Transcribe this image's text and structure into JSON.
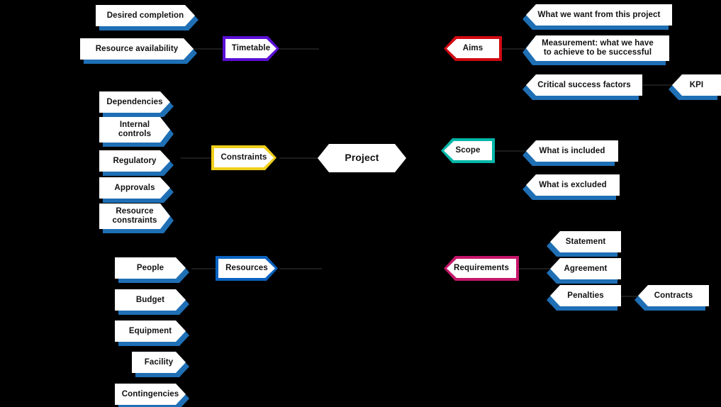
{
  "diagram": {
    "title": "Project scoping chevron diagram",
    "background": "#000000",
    "palette": {
      "shadow_blue": "#1f6fb5",
      "resources_blue": "#0b62c0",
      "timetable_purple": "#5b0fd6",
      "constraints_yellow": "#efcf1a",
      "aims_red": "#d00a12",
      "scope_teal": "#00b6a8",
      "requirements_magenta": "#c5176a",
      "node_fill": "#ffffff",
      "text": "#121212"
    },
    "center": {
      "label": "Project",
      "shape": "hexagon",
      "fill": "#ffffff"
    },
    "branches": [
      {
        "key": "timetable",
        "label": "Timetable",
        "accent": "#5b0fd6",
        "direction": "right",
        "children": [
          "Desired completion",
          "Resource availability"
        ]
      },
      {
        "key": "constraints",
        "label": "Constraints",
        "accent": "#efcf1a",
        "direction": "right",
        "children": [
          "Dependencies",
          "Internal controls",
          "Regulatory",
          "Approvals",
          "Resource constraints"
        ]
      },
      {
        "key": "resources",
        "label": "Resources",
        "accent": "#0b62c0",
        "direction": "right",
        "children": [
          "People",
          "Budget",
          "Equipment",
          "Facility",
          "Contingencies"
        ]
      },
      {
        "key": "aims",
        "label": "Aims",
        "accent": "#d00a12",
        "direction": "left",
        "children": [
          "What we want from this project",
          "Measurement: what we have to achieve to be successful",
          "Critical success factors"
        ],
        "grandchildren": [
          "KPI"
        ]
      },
      {
        "key": "scope",
        "label": "Scope",
        "accent": "#00b6a8",
        "direction": "left",
        "children": [
          "What is included",
          "What is excluded"
        ]
      },
      {
        "key": "requirements",
        "label": "Requirements",
        "accent": "#c5176a",
        "direction": "left",
        "children": [
          "Statement",
          "Agreement",
          "Penalties"
        ],
        "grandchildren": [
          "Contracts"
        ]
      }
    ],
    "nodes": {
      "desired_completion": "Desired completion",
      "resource_availability": "Resource availability",
      "timetable": "Timetable",
      "dependencies": "Dependencies",
      "internal_controls_line1": "Internal",
      "internal_controls_line2": "controls",
      "regulatory": "Regulatory",
      "approvals": "Approvals",
      "resource_constraints_line1": "Resource",
      "resource_constraints_line2": "constraints",
      "constraints": "Constraints",
      "people": "People",
      "budget": "Budget",
      "equipment": "Equipment",
      "facility": "Facility",
      "contingencies": "Contingencies",
      "resources": "Resources",
      "project": "Project",
      "aims": "Aims",
      "what_we_want": "What we want from this project",
      "measurement_line1": "Measurement: what we have",
      "measurement_line2": "to achieve to be successful",
      "critical_success_factors": "Critical success factors",
      "kpi": "KPI",
      "scope": "Scope",
      "what_is_included": "What is included",
      "what_is_excluded": "What is excluded",
      "requirements": "Requirements",
      "statement": "Statement",
      "agreement": "Agreement",
      "penalties": "Penalties",
      "contracts": "Contracts"
    }
  }
}
